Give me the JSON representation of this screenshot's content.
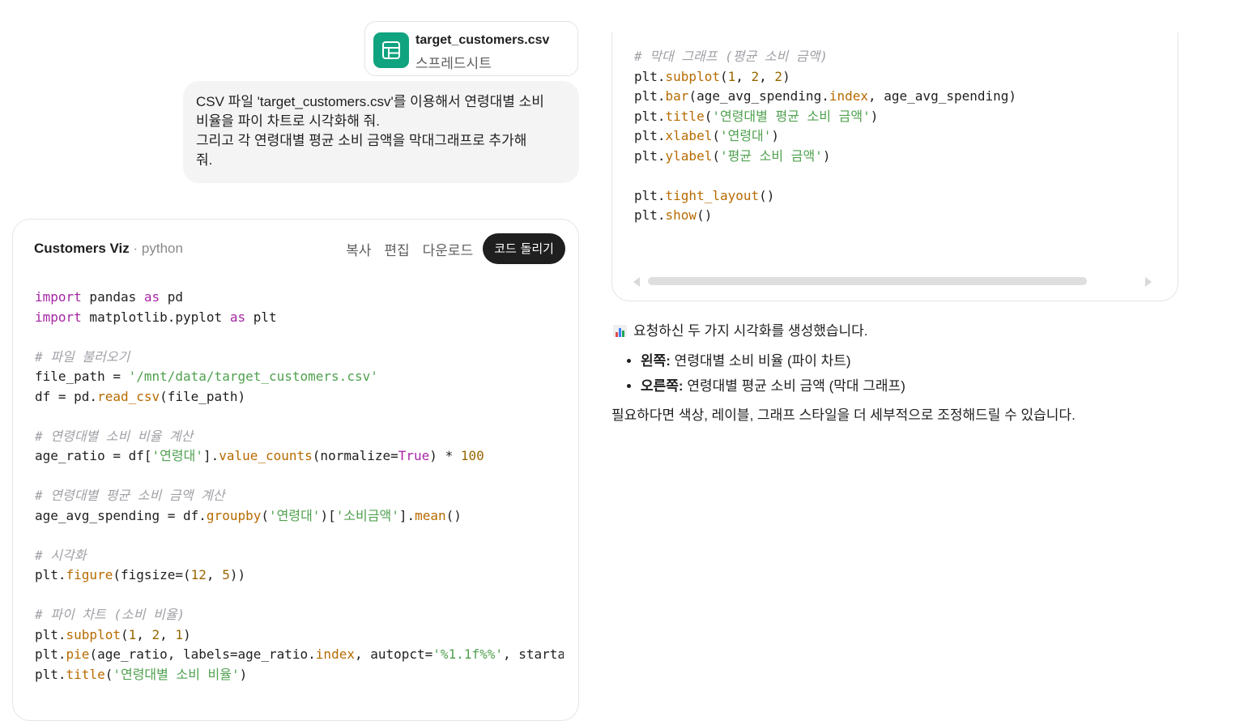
{
  "attachment": {
    "filename": "target_customers.csv",
    "filetype": "스프레드시트"
  },
  "user_message": {
    "line1": "CSV 파일 'target_customers.csv'를 이용해서 연령대별 소비",
    "line2": "비율을 파이 차트로 시각화해 줘.",
    "line3": "그리고 각 연령대별 평균 소비 금액을 막대그래프로 추가해",
    "line4": "줘."
  },
  "code_card": {
    "title": "Customers Viz",
    "language": "· python",
    "copy_label": "복사",
    "edit_label": "편집",
    "download_label": "다운로드",
    "run_label": "코드 돌리기"
  },
  "code_left": [
    "import pandas as pd",
    "import matplotlib.pyplot as plt",
    "",
    "# 파일 불러오기",
    "file_path = '/mnt/data/target_customers.csv'",
    "df = pd.read_csv(file_path)",
    "",
    "# 연령대별 소비 비율 계산",
    "age_ratio = df['연령대'].value_counts(normalize=True) * 100",
    "",
    "# 연령대별 평균 소비 금액 계산",
    "age_avg_spending = df.groupby('연령대')['소비금액'].mean()",
    "",
    "# 시각화",
    "plt.figure(figsize=(12, 5))",
    "",
    "# 파이 차트 (소비 비율)",
    "plt.subplot(1, 2, 1)",
    "plt.pie(age_ratio, labels=age_ratio.index, autopct='%1.1f%%', starta",
    "plt.title('연령대별 소비 비율')"
  ],
  "code_right": [
    "# 막대 그래프 (평균 소비 금액)",
    "plt.subplot(1, 2, 2)",
    "plt.bar(age_avg_spending.index, age_avg_spending)",
    "plt.title('연령대별 평균 소비 금액')",
    "plt.xlabel('연령대')",
    "plt.ylabel('평균 소비 금액')",
    "",
    "plt.tight_layout()",
    "plt.show()"
  ],
  "answer": {
    "intro": "요청하신 두 가지 시각화를 생성했습니다.",
    "bullets": [
      {
        "bold": "왼쪽:",
        "text": " 연령대별 소비 비율 (파이 차트)"
      },
      {
        "bold": "오른쪽:",
        "text": " 연령대별 평균 소비 금액 (막대 그래프)"
      }
    ],
    "outro": "필요하다면 색상, 레이블, 그래프 스타일을 더 세부적으로 조정해드릴 수 있습니다."
  },
  "colors": {
    "accent_green": "#10a37f",
    "run_button_bg": "#1f1f1f",
    "bubble_bg": "#f4f4f4"
  },
  "icons": {
    "attachment": "spreadsheet-icon",
    "answer": "bar-chart-emoji-icon"
  }
}
